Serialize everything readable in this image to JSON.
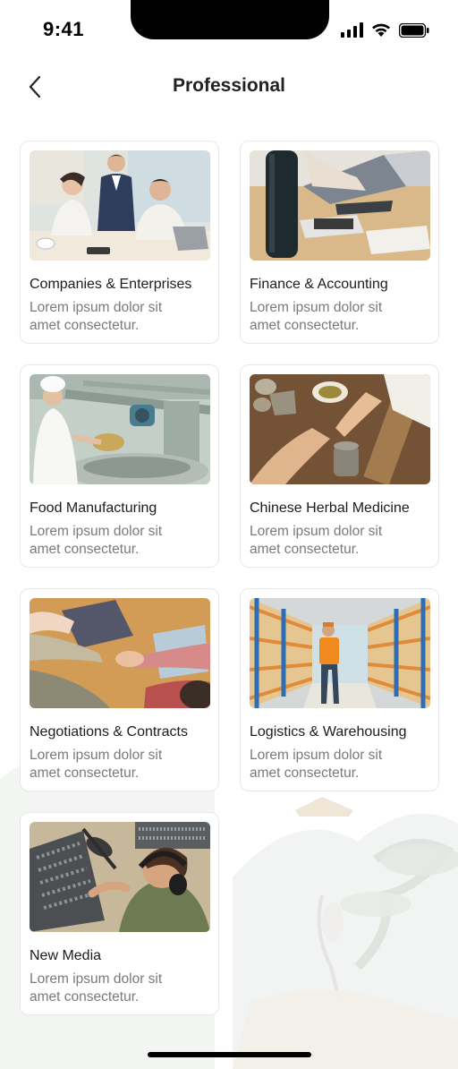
{
  "status_bar": {
    "time": "9:41"
  },
  "header": {
    "title": "Professional"
  },
  "cards": [
    {
      "title": "Companies & Enterprises",
      "desc": "Lorem ipsum dolor sit amet consectetur."
    },
    {
      "title": "Finance & Accounting",
      "desc": "Lorem ipsum dolor sit amet consectetur."
    },
    {
      "title": "Food Manufacturing",
      "desc": "Lorem ipsum dolor sit amet consectetur."
    },
    {
      "title": "Chinese Herbal Medicine",
      "desc": "Lorem ipsum dolor sit amet consectetur."
    },
    {
      "title": "Negotiations & Contracts",
      "desc": "Lorem ipsum dolor sit amet consectetur."
    },
    {
      "title": "Logistics & Warehousing",
      "desc": "Lorem ipsum dolor sit amet consectetur."
    },
    {
      "title": "New Media",
      "desc": "Lorem ipsum dolor sit amet consectetur."
    }
  ],
  "colors": {
    "background": "#ffffff",
    "card_border": "#e8e8ea",
    "desc_text": "#7a7a7e"
  },
  "icons": [
    "back-arrow-icon",
    "signal-icon",
    "wifi-icon",
    "battery-icon"
  ]
}
